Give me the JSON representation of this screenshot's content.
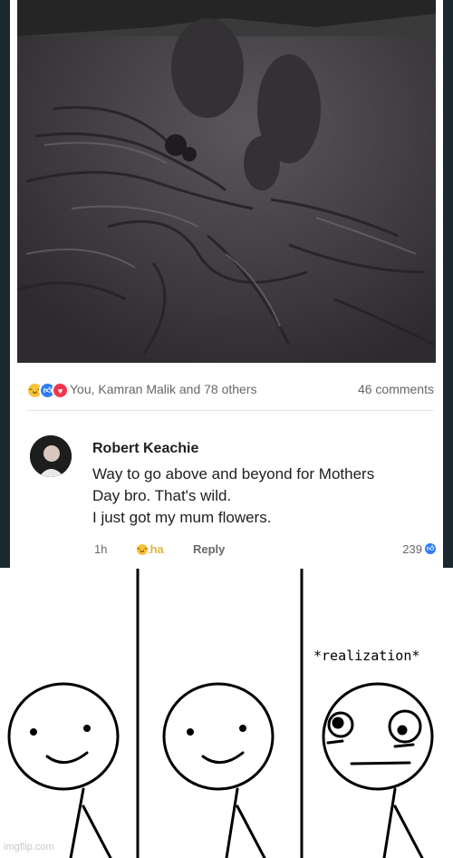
{
  "post": {
    "reactions": {
      "icons": [
        "haha-icon",
        "like-icon",
        "love-icon"
      ],
      "names": "You, Kamran Malik and 78 others",
      "comments": "46 comments"
    },
    "comment": {
      "author": "Robert Keachie",
      "lines": [
        "Way to go above and beyond for Mothers",
        "Day bro. That's wild.",
        "I just got my mum flowers."
      ],
      "time": "1h",
      "haha": "Haha",
      "reply": "Reply",
      "count": "239"
    }
  },
  "comic": {
    "caption": "*realization*",
    "watermark": "imgflip.com"
  },
  "colors": {
    "haha": "#f7c33b",
    "like": "#2f7cf6",
    "love": "#f0364f",
    "page_bg": "#1b2830"
  }
}
